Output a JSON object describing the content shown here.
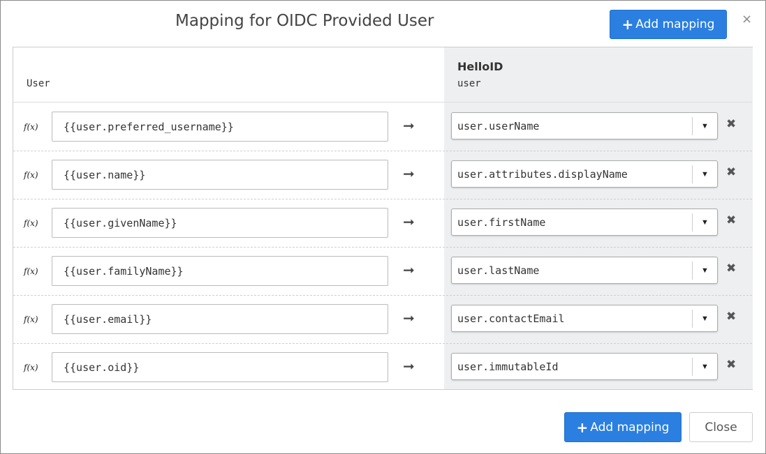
{
  "dialog": {
    "title": "Mapping for OIDC Provided User",
    "add_mapping_label": "Add mapping",
    "close_icon": "×"
  },
  "header": {
    "left_label": "User",
    "right_title": "HelloID",
    "right_label": "user"
  },
  "mappings": [
    {
      "source": "{{user.preferred_username}}",
      "target": "user.userName"
    },
    {
      "source": "{{user.name}}",
      "target": "user.attributes.displayName"
    },
    {
      "source": "{{user.givenName}}",
      "target": "user.firstName"
    },
    {
      "source": "{{user.familyName}}",
      "target": "user.lastName"
    },
    {
      "source": "{{user.email}}",
      "target": "user.contactEmail"
    },
    {
      "source": "{{user.oid}}",
      "target": "user.immutableId"
    }
  ],
  "row_labels": {
    "fx": "f(x)",
    "arrow": "➞",
    "caret": "▼",
    "remove": "✖"
  },
  "footer": {
    "add_mapping_label": "Add mapping",
    "close_label": "Close"
  },
  "colors": {
    "primary": "#2a7fe0",
    "target_column_bg": "#eeeff1"
  },
  "icons": {
    "plus": "plus-icon",
    "close": "close-icon",
    "arrow": "arrow-right-icon",
    "caret": "chevron-down-icon",
    "remove": "remove-icon"
  }
}
